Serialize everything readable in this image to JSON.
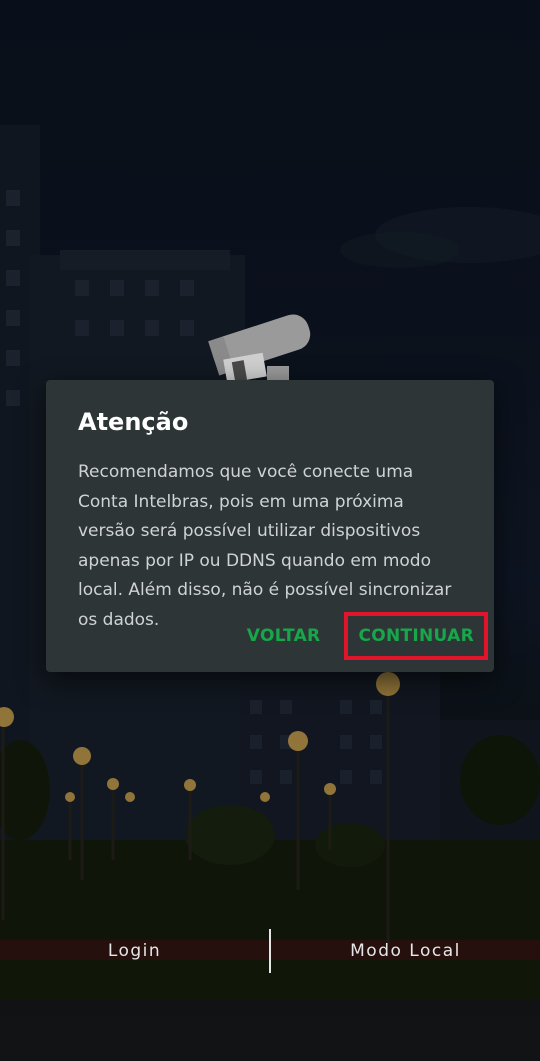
{
  "dialog": {
    "title": "Atenção",
    "message": "Recomendamos que você conecte uma Conta Intelbras, pois em uma próxima versão será possível utilizar dispositivos apenas por IP ou DDNS quando em modo local. Além disso, não é possível sincronizar os dados.",
    "back_label": "VOLTAR",
    "continue_label": "CONTINUAR"
  },
  "bottom_nav": {
    "login_label": "Login",
    "local_mode_label": "Modo Local"
  },
  "colors": {
    "accent_green": "#17a64a",
    "highlight_red": "#e0142a",
    "dialog_bg": "#2e3537"
  },
  "icons": {
    "app_logo": "security-camera-icon"
  }
}
